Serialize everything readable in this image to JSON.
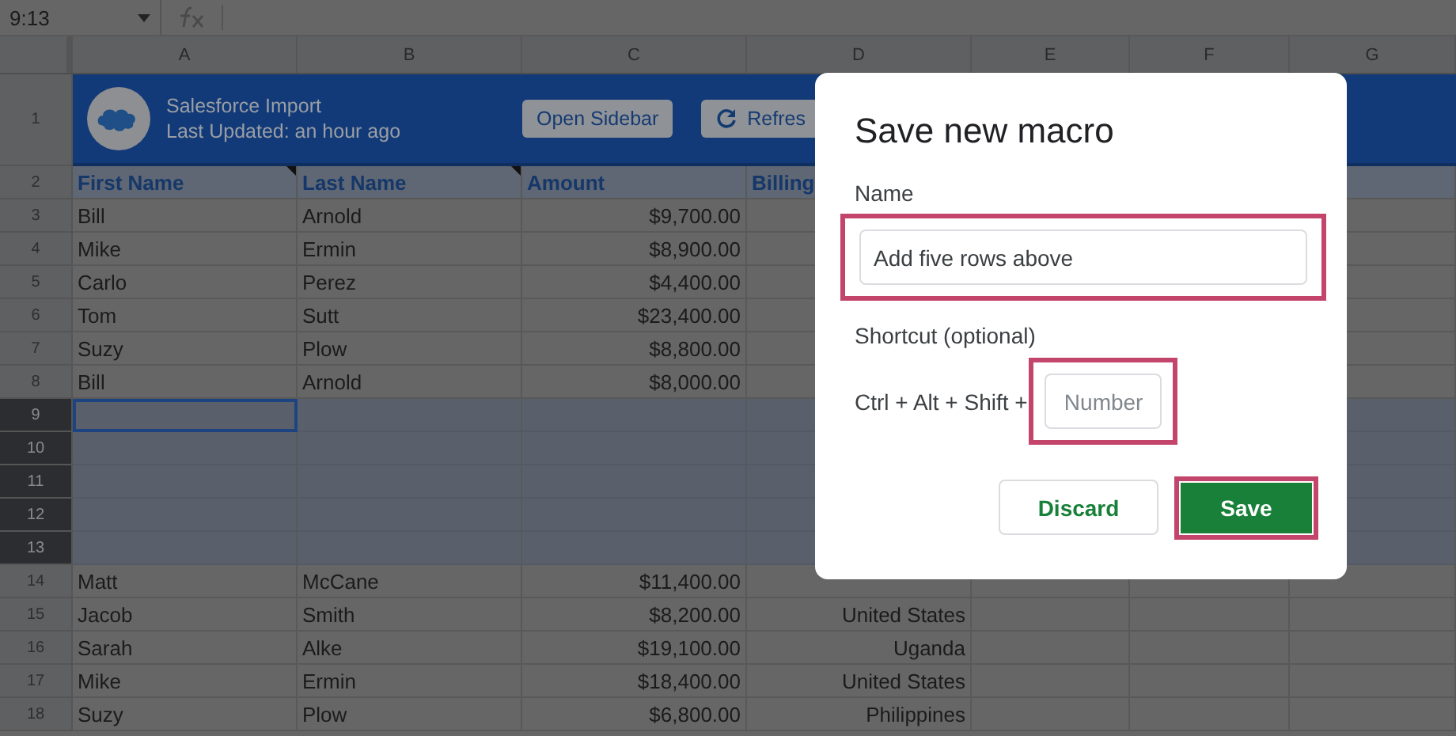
{
  "name_box": {
    "value": "9:13"
  },
  "columns": [
    "A",
    "B",
    "C",
    "D",
    "E",
    "F",
    "G"
  ],
  "banner": {
    "row": "1",
    "title": "Salesforce Import",
    "subtitle": "Last Updated: an hour ago",
    "buttons": [
      {
        "label": "Open Sidebar",
        "kind": "plain"
      },
      {
        "label": "Refres",
        "kind": "refresh"
      }
    ]
  },
  "rows": [
    {
      "number": "2",
      "kind": "header",
      "selected": false,
      "cells": [
        {
          "text": "First Name",
          "note": true
        },
        {
          "text": "Last Name",
          "note": true
        },
        {
          "text": "Amount",
          "note": false
        },
        {
          "text": "Billing",
          "note": false
        }
      ]
    },
    {
      "number": "3",
      "kind": "data",
      "selected": false,
      "cells": [
        {
          "text": "Bill"
        },
        {
          "text": "Arnold"
        },
        {
          "text": "$9,700.00"
        }
      ]
    },
    {
      "number": "4",
      "kind": "data",
      "selected": false,
      "cells": [
        {
          "text": "Mike"
        },
        {
          "text": "Ermin"
        },
        {
          "text": "$8,900.00"
        }
      ]
    },
    {
      "number": "5",
      "kind": "data",
      "selected": false,
      "cells": [
        {
          "text": "Carlo"
        },
        {
          "text": "Perez"
        },
        {
          "text": "$4,400.00"
        }
      ]
    },
    {
      "number": "6",
      "kind": "data",
      "selected": false,
      "cells": [
        {
          "text": "Tom"
        },
        {
          "text": "Sutt"
        },
        {
          "text": "$23,400.00"
        }
      ]
    },
    {
      "number": "7",
      "kind": "data",
      "selected": false,
      "cells": [
        {
          "text": "Suzy"
        },
        {
          "text": "Plow"
        },
        {
          "text": "$8,800.00"
        }
      ]
    },
    {
      "number": "8",
      "kind": "data",
      "selected": false,
      "cells": [
        {
          "text": "Bill"
        },
        {
          "text": "Arnold"
        },
        {
          "text": "$8,000.00"
        }
      ]
    },
    {
      "number": "9",
      "kind": "data",
      "selected": true,
      "cells": []
    },
    {
      "number": "10",
      "kind": "data",
      "selected": true,
      "cells": []
    },
    {
      "number": "11",
      "kind": "data",
      "selected": true,
      "cells": []
    },
    {
      "number": "12",
      "kind": "data",
      "selected": true,
      "cells": []
    },
    {
      "number": "13",
      "kind": "data",
      "selected": true,
      "cells": []
    },
    {
      "number": "14",
      "kind": "data",
      "selected": false,
      "cells": [
        {
          "text": "Matt"
        },
        {
          "text": "McCane"
        },
        {
          "text": "$11,400.00"
        }
      ]
    },
    {
      "number": "15",
      "kind": "data",
      "selected": false,
      "cells": [
        {
          "text": "Jacob"
        },
        {
          "text": "Smith"
        },
        {
          "text": "$8,200.00"
        },
        {
          "text": "United States"
        }
      ]
    },
    {
      "number": "16",
      "kind": "data",
      "selected": false,
      "cells": [
        {
          "text": "Sarah"
        },
        {
          "text": "Alke"
        },
        {
          "text": "$19,100.00"
        },
        {
          "text": "Uganda"
        }
      ]
    },
    {
      "number": "17",
      "kind": "data",
      "selected": false,
      "cells": [
        {
          "text": "Mike"
        },
        {
          "text": "Ermin"
        },
        {
          "text": "$18,400.00"
        },
        {
          "text": "United States"
        }
      ]
    },
    {
      "number": "18",
      "kind": "data",
      "selected": false,
      "cells": [
        {
          "text": "Suzy"
        },
        {
          "text": "Plow"
        },
        {
          "text": "$6,800.00"
        },
        {
          "text": "Philippines"
        }
      ]
    }
  ],
  "dialog": {
    "title": "Save new macro",
    "name_label": "Name",
    "name_value": "Add five rows above",
    "name_highlighted": true,
    "shortcut_label": "Shortcut (optional)",
    "shortcut_prefix": "Ctrl + Alt + Shift +",
    "shortcut_placeholder": "Number",
    "shortcut_highlighted": true,
    "buttons": [
      {
        "label": "Discard",
        "kind": "secondary",
        "highlighted": false
      },
      {
        "label": "Save",
        "kind": "primary",
        "highlighted": true
      }
    ]
  }
}
